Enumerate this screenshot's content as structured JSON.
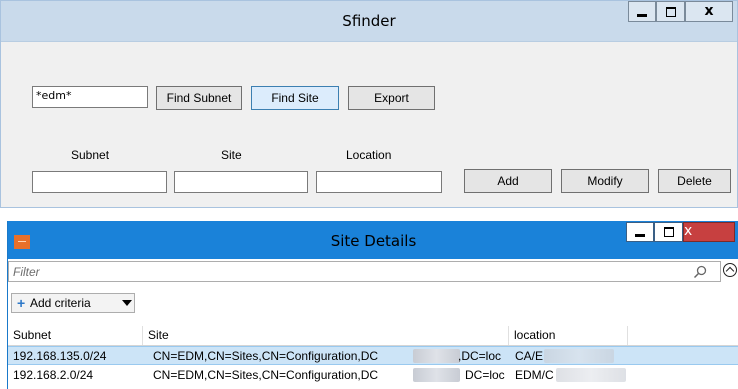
{
  "sfinder": {
    "title": "Sfinder",
    "search_value": "*edm*",
    "find_subnet_label": "Find Subnet",
    "find_site_label": "Find Site",
    "export_label": "Export",
    "subnet_label": "Subnet",
    "site_label": "Site",
    "location_label": "Location",
    "subnet_value": "",
    "site_value": "",
    "location_value": "",
    "add_label": "Add",
    "modify_label": "Modify",
    "delete_label": "Delete",
    "close_glyph": "x"
  },
  "site_details": {
    "title": "Site Details",
    "filter_placeholder": "Filter",
    "add_criteria_label": "Add criteria",
    "close_glyph": "x",
    "columns": [
      "Subnet",
      "Site",
      "location"
    ],
    "rows": [
      {
        "subnet": "192.168.135.0/24",
        "site_a": "CN=EDM,CN=Sites,CN=Configuration,DC",
        "site_b": ",DC=loc",
        "location": "CA/E"
      },
      {
        "subnet": "192.168.2.0/24",
        "site_a": "CN=EDM,CN=Sites,CN=Configuration,DC",
        "site_b": "DC=loc",
        "location": "EDM/C"
      }
    ]
  },
  "colors": {
    "sfinder_titlebar": "#c9daeb",
    "details_titlebar": "#1a82d9",
    "selected_row": "#cce4f7",
    "close_button": "#c74040"
  },
  "icons": [
    "minimize-icon",
    "maximize-icon",
    "close-icon",
    "app-icon",
    "search-icon",
    "collapse-up-icon",
    "plus-icon",
    "dropdown-caret-icon"
  ]
}
